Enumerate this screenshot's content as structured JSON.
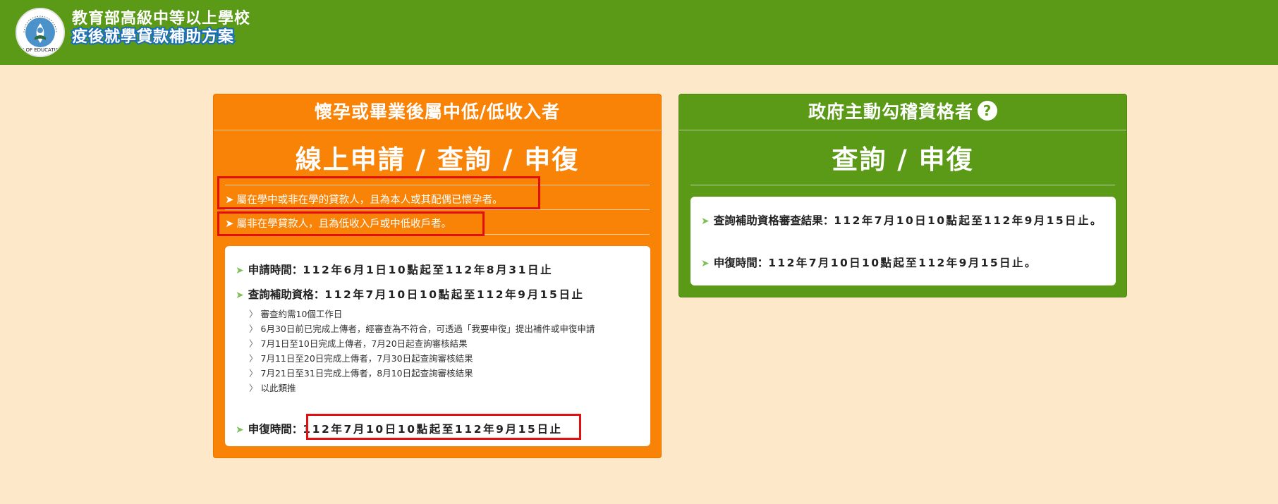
{
  "header": {
    "logo_text": "MINISTRY OF EDUCATION 教育部",
    "title_line1": "教育部高級中等以上學校",
    "title_line2": "疫後就學貸款補助方案"
  },
  "left_panel": {
    "heading": "懷孕或畢業後屬中低/低收入者",
    "big_title": "線上申請 / 查詢 / 申復",
    "conditions": [
      "屬在學中或非在學的貸款人，且為本人或其配偶已懷孕者。",
      "屬非在學貸款人，且為低收入戶或中低收戶者。"
    ],
    "apply_label": "申請時間：",
    "apply_value": "112年6月1日10點起至112年8月31日止",
    "check_label": "查詢補助資格：",
    "check_value": "112年7月10日10點起至112年9月15日止",
    "notes": [
      "審查約需10個工作日",
      "6月30日前已完成上傳者，經審查為不符合，可透過「我要申復」提出補件或申復申請",
      "7月1日至10日完成上傳者，7月20日起查詢審核結果",
      "7月11日至20日完成上傳者，7月30日起查詢審核結果",
      "7月21日至31日完成上傳者，8月10日起查詢審核結果",
      "以此類推"
    ],
    "appeal_label": "申復時間：",
    "appeal_value": "112年7月10日10點起至112年9月15日止"
  },
  "right_panel": {
    "heading": "政府主動勾稽資格者",
    "help_symbol": "?",
    "big_title": "查詢 / 申復",
    "result_label": "查詢補助資格審查結果：",
    "result_value": "112年7月10日10點起至112年9月15日止。",
    "appeal_label": "申復時間：",
    "appeal_value": "112年7月10日10點起至112年9月15日止。"
  },
  "colors": {
    "header_green": "#5a9a16",
    "panel_orange": "#f98306",
    "highlight_red": "#e01010",
    "background": "#fde9c9"
  }
}
